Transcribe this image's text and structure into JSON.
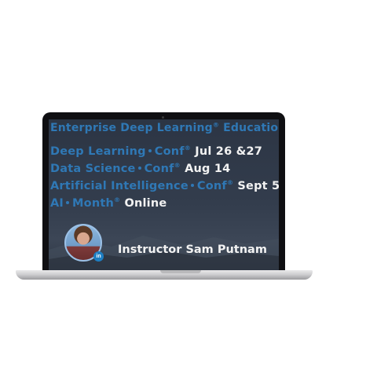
{
  "screen": {
    "headline": {
      "part1": "Enterprise Deep Learning",
      "reg": "®",
      "part2": " Education"
    },
    "events": [
      {
        "a": "Deep Learning",
        "b": "Conf",
        "reg": "®",
        "date": " Jul 26 &27"
      },
      {
        "a": "Data Science",
        "b": "Conf",
        "reg": "®",
        "date": "  Aug 14"
      },
      {
        "a": "Artificial Intelligence",
        "b": "Conf",
        "reg": "®",
        "date": " Sept 5"
      },
      {
        "a": "AI",
        "b": "Month",
        "reg": "®",
        "date": " Online"
      }
    ],
    "instructor": "Instructor Sam Putnam",
    "linkedin_badge": "in"
  },
  "colors": {
    "accent_blue": "#2f78b5",
    "text_white": "#f2f2f2",
    "screen_bg": "#2c3544"
  }
}
